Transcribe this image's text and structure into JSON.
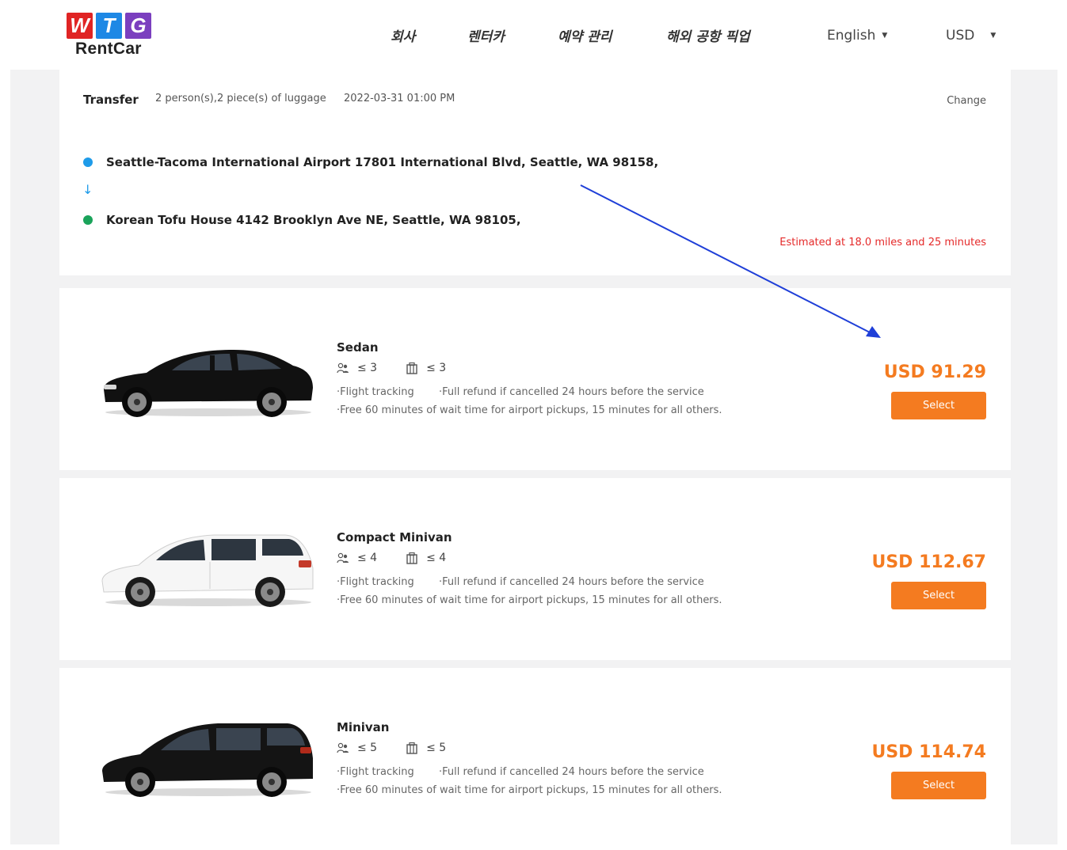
{
  "header": {
    "logo": {
      "letters": [
        "W",
        "T",
        "G"
      ],
      "letter_colors": [
        "#e02424",
        "#1e88e5",
        "#7b3fbf"
      ],
      "text": "RentCar"
    },
    "nav": [
      "회사",
      "렌터카",
      "예약 관리",
      "해외 공항 픽업"
    ],
    "language": "English",
    "currency": "USD"
  },
  "trip": {
    "type": "Transfer",
    "passengers": "2 person(s),2 piece(s) of luggage",
    "datetime": "2022-03-31 01:00 PM",
    "change_label": "Change",
    "pickup": "Seattle-Tacoma International Airport 17801 International Blvd, Seattle, WA 98158,",
    "dropoff": "Korean Tofu House 4142 Brooklyn Ave NE, Seattle, WA 98105,",
    "estimate": "Estimated at 18.0 miles and 25 minutes",
    "pickup_color": "#1e9be9",
    "dropoff_color": "#1aa35a"
  },
  "vehicles": [
    {
      "name": "Sedan",
      "passengers": "≤ 3",
      "luggage": "≤ 3",
      "feature1": "·Flight tracking",
      "feature2": "·Full refund if cancelled 24 hours before the service",
      "feature3": "·Free 60 minutes of wait time for airport pickups, 15 minutes for all others.",
      "price": "USD 91.29",
      "select_label": "Select",
      "color": "#111111"
    },
    {
      "name": "Compact Minivan",
      "passengers": "≤ 4",
      "luggage": "≤ 4",
      "feature1": "·Flight tracking",
      "feature2": "·Full refund if cancelled 24 hours before the service",
      "feature3": "·Free 60 minutes of wait time for airport pickups, 15 minutes for all others.",
      "price": "USD 112.67",
      "select_label": "Select",
      "color": "#f4f4f4"
    },
    {
      "name": "Minivan",
      "passengers": "≤ 5",
      "luggage": "≤ 5",
      "feature1": "·Flight tracking",
      "feature2": "·Full refund if cancelled 24 hours before the service",
      "feature3": "·Free 60 minutes of wait time for airport pickups, 15 minutes for all others.",
      "price": "USD 114.74",
      "select_label": "Select",
      "color": "#141414"
    }
  ],
  "colors": {
    "accent": "#f47b20",
    "estimate": "#e52a2a",
    "annotation_arrow": "#1f3fd8"
  }
}
